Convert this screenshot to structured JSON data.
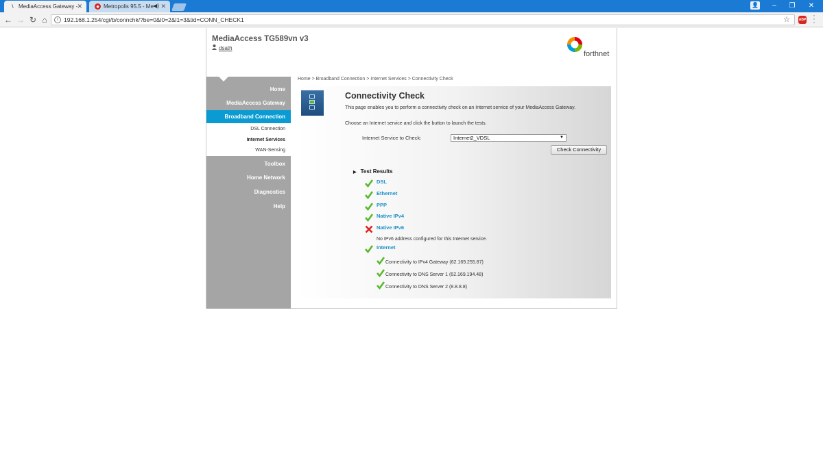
{
  "browser": {
    "tabs": [
      {
        "label": "MediaAccess Gateway - ",
        "active": true
      },
      {
        "label": "Metropolis 95.5 - Me",
        "active": false
      }
    ],
    "url": "192.168.1.254/cgi/b/connchk/?be=0&l0=2&l1=3&tid=CONN_CHECK1",
    "abp_label": "ABP",
    "window_controls": {
      "minimize": "–",
      "maximize": "❐",
      "close": "✕"
    }
  },
  "header": {
    "product": "MediaAccess TG589vn v3",
    "user": "dsath",
    "brand": "forthnet"
  },
  "sidebar": {
    "items": [
      {
        "label": "Home"
      },
      {
        "label": "MediaAccess Gateway"
      },
      {
        "label": "Broadband Connection",
        "active": true
      },
      {
        "label": "Toolbox"
      },
      {
        "label": "Home Network"
      },
      {
        "label": "Diagnostics"
      },
      {
        "label": "Help"
      }
    ],
    "subitems": [
      {
        "label": "DSL Connection"
      },
      {
        "label": "Internet Services",
        "current": true
      },
      {
        "label": "WAN-Sensing"
      }
    ]
  },
  "breadcrumb": "Home > Broadband Connection > Internet Services > Connectivity Check",
  "panel": {
    "title": "Connectivity Check",
    "description": "This page enables you to perform a connectivity check on an Internet service of your MediaAccess Gateway.",
    "instruction": "Choose an Internet service and click the button to launch the tests.",
    "field_label": "Internet Service to Check:",
    "selected_service": "Internet2_VDSL",
    "button_label": "Check Connectivity"
  },
  "results": {
    "heading": "Test Results",
    "tests": [
      {
        "label": "DSL",
        "status": "pass"
      },
      {
        "label": "Ethernet",
        "status": "pass"
      },
      {
        "label": "PPP",
        "status": "pass"
      },
      {
        "label": "Native IPv4",
        "status": "pass"
      },
      {
        "label": "Native IPv6",
        "status": "fail"
      },
      {
        "label": "Internet",
        "status": "pass"
      }
    ],
    "ipv6_note": "No IPv6 address configured for this Internet service.",
    "internet_checks": [
      {
        "label": "Connectivity to IPv4 Gateway (62.169.255.87)",
        "status": "pass"
      },
      {
        "label": "Connectivity to DNS Server 1 (62.169.194.48)",
        "status": "pass"
      },
      {
        "label": "Connectivity to DNS Server 2 (8.8.8.8)",
        "status": "pass"
      }
    ]
  },
  "colors": {
    "pass": "#5bb82e",
    "fail": "#e02020",
    "accent": "#0a9bd3",
    "link": "#1a8fc9"
  }
}
